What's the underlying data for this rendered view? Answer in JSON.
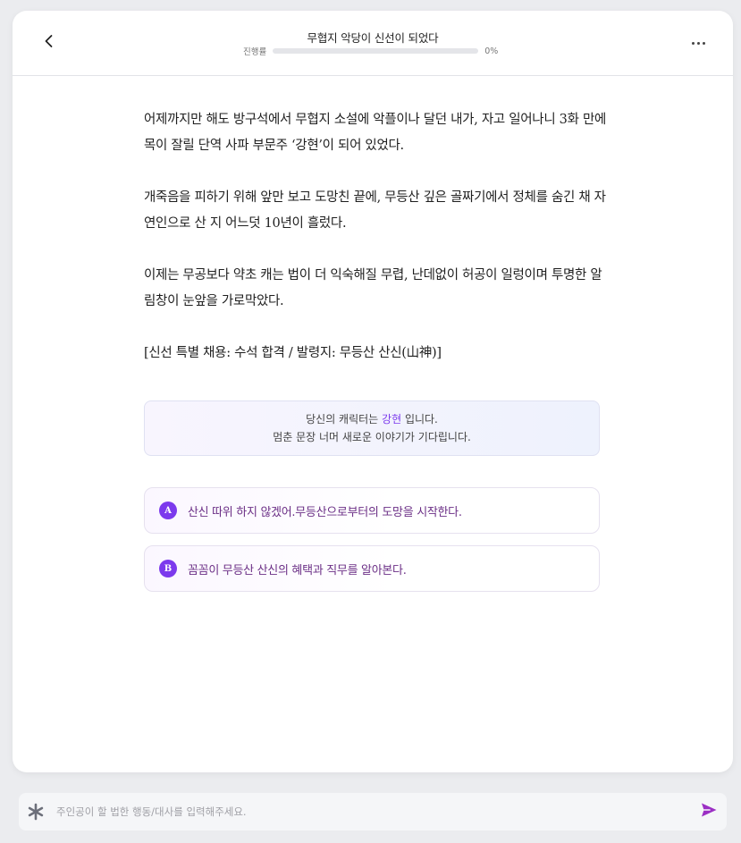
{
  "header": {
    "title": "무협지 악당이 신선이 되었다",
    "progress_label": "진행률",
    "progress_value": "0%",
    "progress_fraction": 0
  },
  "story": {
    "paragraphs": [
      "어제까지만 해도 방구석에서 무협지 소설에 악플이나 달던 내가, 자고 일어나니 3화 만에 목이 잘릴 단역 사파 부문주 ‘강현’이 되어 있었다.",
      "개죽음을 피하기 위해 앞만 보고 도망친 끝에, 무등산 깊은 골짜기에서 정체를 숨긴 채 자연인으로 산 지 어느덧 10년이 흘렀다.",
      "이제는 무공보다 약초 캐는 법이 더 익숙해질 무렵, 난데없이 허공이 일렁이며 투명한 알림창이 눈앞을 가로막았다.",
      "[신선 특별 채용: 수석 합격 / 발령지: 무등산 산신(山神)]"
    ]
  },
  "notice": {
    "line1_prefix": "당신의 캐릭터는 ",
    "character_name": "강현",
    "line1_suffix": " 입니다.",
    "line2": "멈춘 문장 너머 새로운 이야기가 기다립니다."
  },
  "choices": [
    {
      "badge": "A",
      "text": "산신 따위 하지 않겠어.무등산으로부터의 도망을 시작한다."
    },
    {
      "badge": "B",
      "text": "꼼꼼이 무등산 산신의 혜택과 직무를 알아본다."
    }
  ],
  "input": {
    "placeholder": "주인공이 할 법한 행동/대사를 입력해주세요.",
    "value": ""
  },
  "icons": {
    "back": "chevron-left-icon",
    "more": "more-horizontal-icon",
    "asterisk": "asterisk-icon",
    "send": "send-icon"
  },
  "colors": {
    "accent": "#7c3aed",
    "choice_text": "#6b2f86",
    "send": "#9b2fc4",
    "background": "#ebecef"
  }
}
